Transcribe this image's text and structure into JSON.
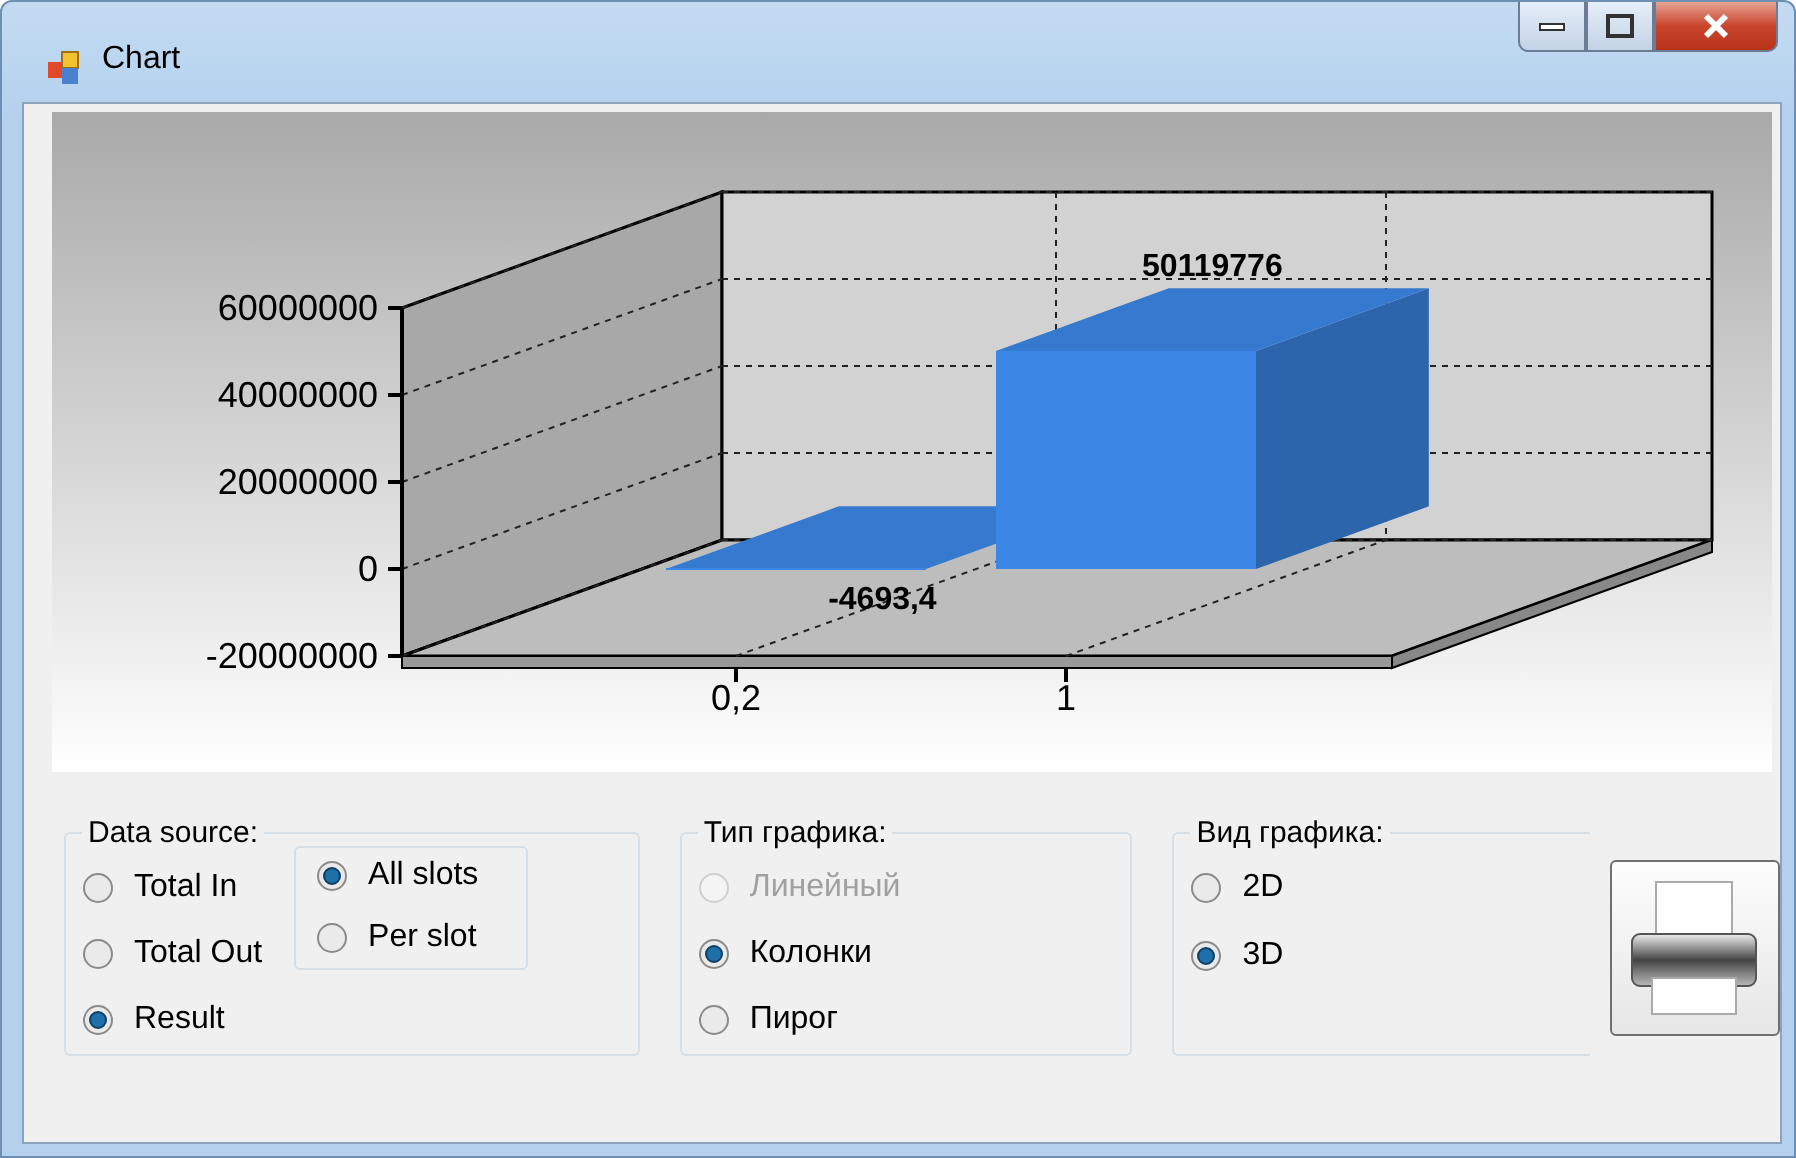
{
  "window": {
    "title": "Chart"
  },
  "chart": {
    "chart_data": {
      "type": "bar",
      "categories": [
        "0,2",
        "1"
      ],
      "series": [
        {
          "color": "#3c87e6",
          "values": [
            -4693.4,
            50119776
          ]
        }
      ],
      "yticks": [
        -20000000,
        0,
        20000000,
        40000000,
        60000000
      ],
      "ylim": [
        -20000000,
        60000000
      ],
      "value_labels": [
        "-4693,4",
        "50119776"
      ]
    }
  },
  "groups": [
    {
      "title": "Data source:",
      "options": [
        {
          "label": "Total In",
          "selected": false,
          "disabled": false
        },
        {
          "label": "Total Out",
          "selected": false,
          "disabled": false
        },
        {
          "label": "Result",
          "selected": true,
          "disabled": false
        }
      ],
      "subgroup": {
        "options": [
          {
            "label": "All slots",
            "selected": true,
            "disabled": false
          },
          {
            "label": "Per slot",
            "selected": false,
            "disabled": false
          }
        ]
      }
    },
    {
      "title": "Тип графика:",
      "options": [
        {
          "label": "Линейный",
          "selected": false,
          "disabled": true
        },
        {
          "label": "Колонки",
          "selected": true,
          "disabled": false
        },
        {
          "label": "Пирог",
          "selected": false,
          "disabled": false
        }
      ]
    },
    {
      "title": "Вид графика:",
      "options": [
        {
          "label": "2D",
          "selected": false,
          "disabled": false
        },
        {
          "label": "3D",
          "selected": true,
          "disabled": false
        }
      ]
    }
  ]
}
